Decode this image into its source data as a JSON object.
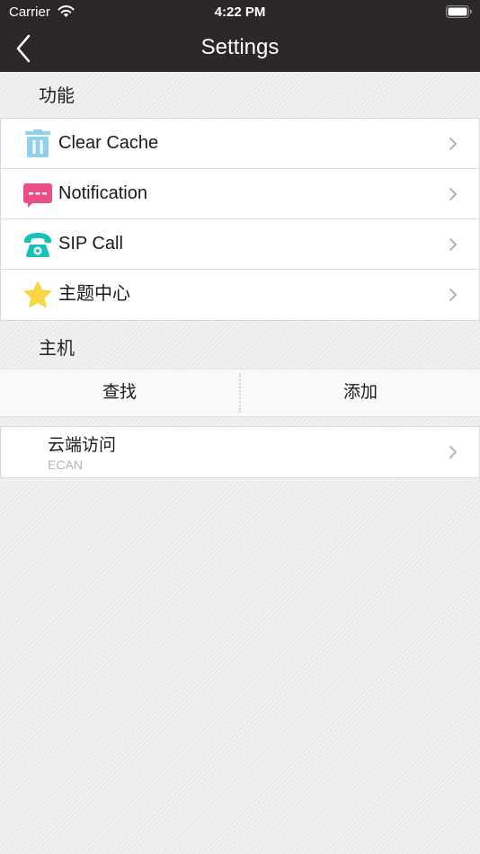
{
  "status_bar": {
    "carrier": "Carrier",
    "time": "4:22 PM"
  },
  "nav": {
    "title": "Settings"
  },
  "features": {
    "header": "功能",
    "items": [
      {
        "label": "Clear Cache",
        "icon": "trash-icon",
        "color": "#8fd0ee"
      },
      {
        "label": "Notification",
        "icon": "message-icon",
        "color": "#ea4e86"
      },
      {
        "label": "SIP Call",
        "icon": "phone-icon",
        "color": "#17c2b4"
      },
      {
        "label": "主题中心",
        "icon": "star-icon",
        "color": "#f7d640"
      }
    ]
  },
  "host": {
    "header": "主机",
    "find_label": "查找",
    "add_label": "添加"
  },
  "cloud": {
    "title": "云端访问",
    "subtitle": "ECAN"
  },
  "colors": {
    "nav_bar": "#2c2729",
    "background": "#ececec"
  }
}
